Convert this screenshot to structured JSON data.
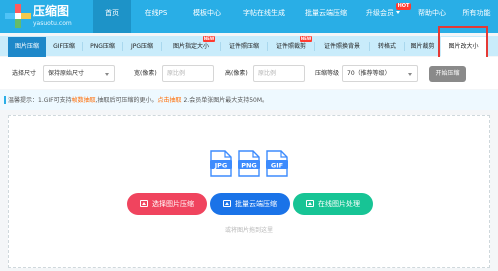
{
  "brand": {
    "name": "压缩图",
    "domain": "yasuotu.com",
    "accent_color": "#29aee6"
  },
  "nav": {
    "items": [
      {
        "label": "首页",
        "active": true
      },
      {
        "label": "在线PS"
      },
      {
        "label": "模板中心"
      },
      {
        "label": "字帖在线生成"
      },
      {
        "label": "批量云端压缩"
      },
      {
        "label": "升级会员",
        "badge": "HOT",
        "has_dropdown": true
      },
      {
        "label": "帮助中心"
      },
      {
        "label": "所有功能"
      }
    ]
  },
  "tabs": {
    "items": [
      {
        "label": "图片压缩",
        "active": true
      },
      {
        "label": "GIF压缩"
      },
      {
        "label": "PNG压缩"
      },
      {
        "label": "JPG压缩"
      },
      {
        "label": "图片指定大小",
        "badge": "NEW"
      },
      {
        "label": "证件照压缩"
      },
      {
        "label": "证件照裁剪",
        "badge": "NEW"
      },
      {
        "label": "证件照换背景"
      },
      {
        "label": "转格式"
      },
      {
        "label": "图片裁剪"
      },
      {
        "label": "图片改大小"
      }
    ]
  },
  "settings": {
    "size_label": "选择尺寸",
    "size_value": "保持原始尺寸",
    "width_label": "宽(像素)",
    "width_placeholder": "原比例",
    "height_label": "高(像素)",
    "height_placeholder": "原比例",
    "quality_label": "压缩等级",
    "quality_value": "70（推荐等级）",
    "start_button": "开始压缩"
  },
  "tip": {
    "prefix": "温馨提示：1.GIF可支持",
    "link1": "帧数抽取",
    "middle": ",抽取后可压缩的更小。",
    "link2": "点击抽取",
    "suffix": " 2.会员单张图片最大支持50M。"
  },
  "upload": {
    "file_types": [
      {
        "label": "JPG",
        "color": "#3d8bfd"
      },
      {
        "label": "PNG",
        "color": "#3d8bfd"
      },
      {
        "label": "GIF",
        "color": "#3d8bfd"
      }
    ],
    "pick_button": "选择图片压缩",
    "cloud_button": "批量云端压缩",
    "online_button": "在线图片处理",
    "hint": "或将图片拖到这里"
  }
}
